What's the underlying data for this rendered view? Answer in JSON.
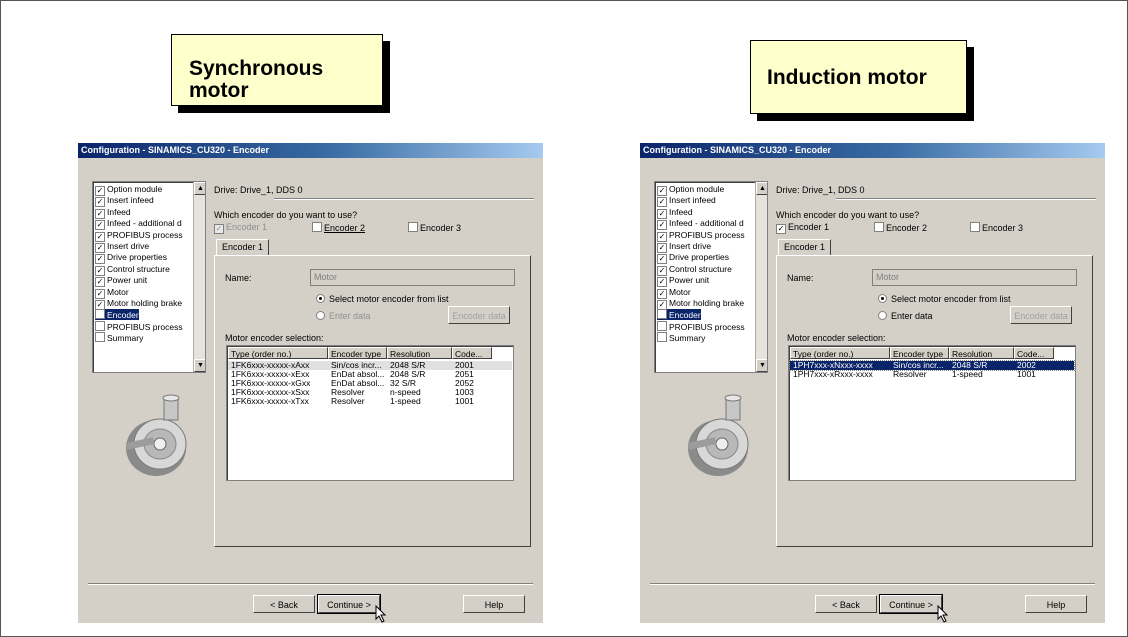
{
  "callouts": {
    "left": {
      "line1": "Synchronous",
      "line2": "motor"
    },
    "right": {
      "line1": "Induction motor"
    }
  },
  "dialogs": [
    {
      "title": "Configuration - SINAMICS_CU320 - Encoder",
      "drive_label": "Drive: Drive_1, DDS 0",
      "question": "Which encoder do you want to use?",
      "encoders": [
        {
          "label": "Encoder 1",
          "checked": true,
          "disabled": true
        },
        {
          "label": "Encoder 2",
          "checked": false,
          "disabled": false
        },
        {
          "label": "Encoder 3",
          "checked": false,
          "disabled": false
        }
      ],
      "tab": "Encoder 1",
      "name_label": "Name:",
      "name_value": "Motor",
      "radio_select": "Select motor encoder from list",
      "radio_enter": "Enter data",
      "encoder_data_btn": "Encoder data",
      "selection_label": "Motor encoder selection:",
      "columns": [
        "Type (order no.)",
        "Encoder type",
        "Resolution",
        "Code..."
      ],
      "rows": [
        [
          "1FK6xxx-xxxxx-xAxx",
          "Sin/cos incr...",
          "2048 S/R",
          "2001"
        ],
        [
          "1FK6xxx-xxxxx-xExx",
          "EnDat absol...",
          "2048 S/R",
          "2051"
        ],
        [
          "1FK6xxx-xxxxx-xGxx",
          "EnDat absol...",
          "32 S/R",
          "2052"
        ],
        [
          "1FK6xxx-xxxxx-xSxx",
          "Resolver",
          "n-speed",
          "1003"
        ],
        [
          "1FK6xxx-xxxxx-xTxx",
          "Resolver",
          "1-speed",
          "1001"
        ]
      ],
      "nav": [
        "Option module",
        "Insert infeed",
        "Infeed",
        "Infeed - additional d",
        "PROFIBUS process",
        "Insert drive",
        "Drive properties",
        "Control structure",
        "Power unit",
        "Motor",
        "Motor holding brake",
        "Encoder",
        "PROFIBUS process",
        "Summary"
      ],
      "back_btn": "< Back",
      "continue_btn": "Continue >",
      "help_btn": "Help"
    },
    {
      "title": "Configuration - SINAMICS_CU320 - Encoder",
      "drive_label": "Drive: Drive_1, DDS 0",
      "question": "Which encoder do you want to use?",
      "encoders": [
        {
          "label": "Encoder 1",
          "checked": true,
          "disabled": false
        },
        {
          "label": "Encoder 2",
          "checked": false,
          "disabled": false
        },
        {
          "label": "Encoder 3",
          "checked": false,
          "disabled": false
        }
      ],
      "tab": "Encoder 1",
      "name_label": "Name:",
      "name_value": "Motor",
      "radio_select": "Select motor encoder from list",
      "radio_enter": "Enter data",
      "encoder_data_btn": "Encoder data",
      "selection_label": "Motor encoder selection:",
      "columns": [
        "Type (order no.)",
        "Encoder type",
        "Resolution",
        "Code..."
      ],
      "rows": [
        [
          "1PH7xxx-xNxxx-xxxx",
          "Sin/cos incr...",
          "2048 S/R",
          "2002"
        ],
        [
          "1PH7xxx-xRxxx-xxxx",
          "Resolver",
          "1-speed",
          "1001"
        ]
      ],
      "nav": [
        "Option module",
        "Insert infeed",
        "Infeed",
        "Infeed - additional d",
        "PROFIBUS process",
        "Insert drive",
        "Drive properties",
        "Control structure",
        "Power unit",
        "Motor",
        "Motor holding brake",
        "Encoder",
        "PROFIBUS process",
        "Summary"
      ],
      "back_btn": "< Back",
      "continue_btn": "Continue >",
      "help_btn": "Help"
    }
  ]
}
